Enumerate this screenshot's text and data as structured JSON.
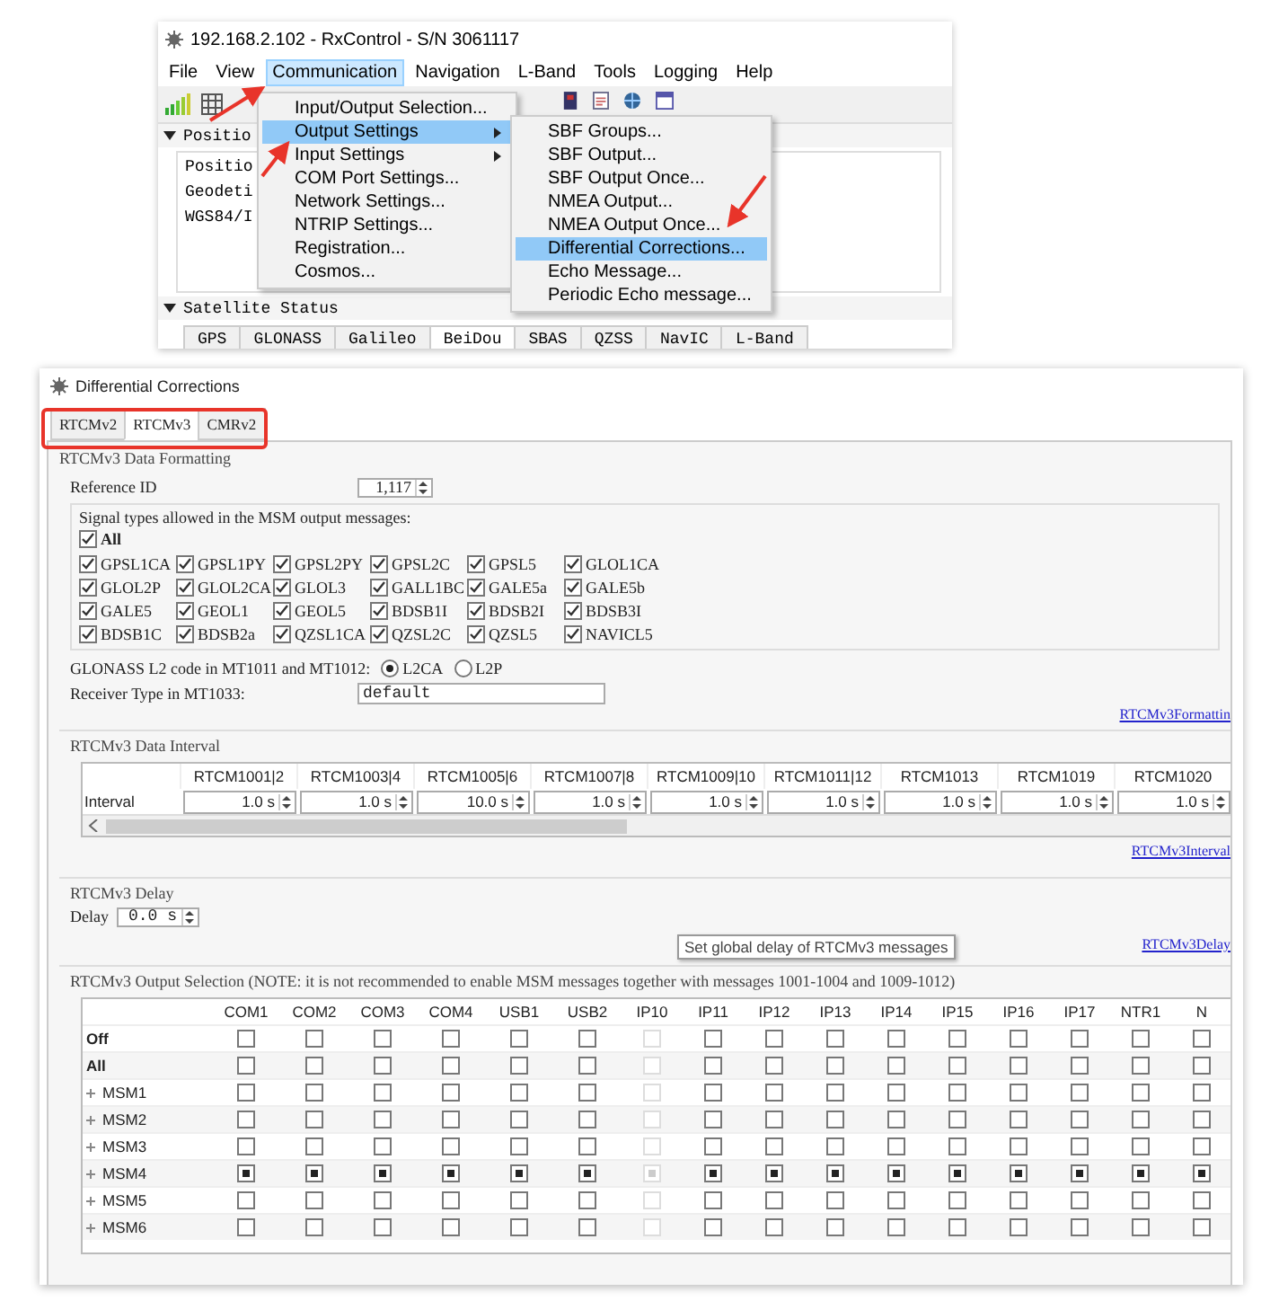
{
  "top_window": {
    "title": "192.168.2.102 - RxControl - S/N 3061117",
    "menu": [
      {
        "label": "File",
        "selected": false
      },
      {
        "label": "View",
        "selected": false
      },
      {
        "label": "Communication",
        "selected": true
      },
      {
        "label": "Navigation",
        "selected": false
      },
      {
        "label": "L-Band",
        "selected": false
      },
      {
        "label": "Tools",
        "selected": false
      },
      {
        "label": "Logging",
        "selected": false
      },
      {
        "label": "Help",
        "selected": false
      }
    ],
    "position_panel": {
      "header": "Positio",
      "tab": "Positio",
      "lines": [
        "Geodeti",
        "WGS84/I"
      ]
    },
    "satellite_panel": {
      "header": "Satellite Status",
      "tabs": [
        {
          "label": "GPS",
          "selected": false
        },
        {
          "label": "GLONASS",
          "selected": false
        },
        {
          "label": "Galileo",
          "selected": false
        },
        {
          "label": "BeiDou",
          "selected": true
        },
        {
          "label": "SBAS",
          "selected": false
        },
        {
          "label": "QZSS",
          "selected": false
        },
        {
          "label": "NavIC",
          "selected": false
        },
        {
          "label": "L-Band",
          "selected": false
        }
      ]
    },
    "dropdown": [
      {
        "label": "Input/Output Selection...",
        "submenu": false,
        "selected": false
      },
      {
        "label": "Output Settings",
        "submenu": true,
        "selected": true
      },
      {
        "label": "Input Settings",
        "submenu": true,
        "selected": false
      },
      {
        "label": "COM Port Settings...",
        "submenu": false,
        "selected": false
      },
      {
        "label": "Network Settings...",
        "submenu": false,
        "selected": false
      },
      {
        "label": "NTRIP Settings...",
        "submenu": false,
        "selected": false
      },
      {
        "label": "Registration...",
        "submenu": false,
        "selected": false
      },
      {
        "label": "Cosmos...",
        "submenu": false,
        "selected": false
      }
    ],
    "submenu": [
      {
        "label": "SBF Groups...",
        "selected": false
      },
      {
        "label": "SBF Output...",
        "selected": false
      },
      {
        "label": "SBF Output Once...",
        "selected": false
      },
      {
        "label": "NMEA Output...",
        "selected": false
      },
      {
        "label": "NMEA Output Once...",
        "selected": false
      },
      {
        "label": "Differential Corrections...",
        "selected": true
      },
      {
        "label": "Echo Message...",
        "selected": false
      },
      {
        "label": "Periodic Echo message...",
        "selected": false
      }
    ]
  },
  "dialog": {
    "title": "Differential Corrections",
    "tabs": [
      {
        "label": "RTCMv2",
        "selected": false
      },
      {
        "label": "RTCMv3",
        "selected": true
      },
      {
        "label": "CMRv2",
        "selected": false
      }
    ],
    "formatting": {
      "title": "RTCMv3 Data Formatting",
      "reference_id": {
        "label": "Reference ID",
        "value": "1,117"
      },
      "signals": {
        "title": "Signal types allowed in the MSM output messages:",
        "all": {
          "label": "All",
          "checked": true
        },
        "items": [
          {
            "label": "GPSL1CA",
            "checked": true
          },
          {
            "label": "GPSL1PY",
            "checked": true
          },
          {
            "label": "GPSL2PY",
            "checked": true
          },
          {
            "label": "GPSL2C",
            "checked": true
          },
          {
            "label": "GPSL5",
            "checked": true
          },
          {
            "label": "GLOL1CA",
            "checked": true
          },
          {
            "label": "GLOL2P",
            "checked": true
          },
          {
            "label": "GLOL2CA",
            "checked": true
          },
          {
            "label": "GLOL3",
            "checked": true
          },
          {
            "label": "GALL1BC",
            "checked": true
          },
          {
            "label": "GALE5a",
            "checked": true
          },
          {
            "label": "GALE5b",
            "checked": true
          },
          {
            "label": "GALE5",
            "checked": true
          },
          {
            "label": "GEOL1",
            "checked": true
          },
          {
            "label": "GEOL5",
            "checked": true
          },
          {
            "label": "BDSB1I",
            "checked": true
          },
          {
            "label": "BDSB2I",
            "checked": true
          },
          {
            "label": "BDSB3I",
            "checked": true
          },
          {
            "label": "BDSB1C",
            "checked": true
          },
          {
            "label": "BDSB2a",
            "checked": true
          },
          {
            "label": "QZSL1CA",
            "checked": true
          },
          {
            "label": "QZSL2C",
            "checked": true
          },
          {
            "label": "QZSL5",
            "checked": true
          },
          {
            "label": "NAVICL5",
            "checked": true
          }
        ]
      },
      "glonass": {
        "label": "GLONASS L2 code in MT1011 and MT1012:",
        "options": [
          {
            "label": "L2CA",
            "selected": true
          },
          {
            "label": "L2P",
            "selected": false
          }
        ]
      },
      "receiver_type": {
        "label": "Receiver Type in MT1033:",
        "value": "default"
      },
      "link": "RTCMv3Formattin"
    },
    "interval": {
      "title": "RTCMv3 Data Interval",
      "columns": [
        "RTCM1001|2",
        "RTCM1003|4",
        "RTCM1005|6",
        "RTCM1007|8",
        "RTCM1009|10",
        "RTCM1011|12",
        "RTCM1013",
        "RTCM1019",
        "RTCM1020"
      ],
      "row_label": "Interval",
      "values": [
        "1.0 s",
        "1.0 s",
        "10.0 s",
        "1.0 s",
        "1.0 s",
        "1.0 s",
        "1.0 s",
        "1.0 s",
        "1.0 s"
      ],
      "link": "RTCMv3Interval"
    },
    "delay": {
      "title": "RTCMv3 Delay",
      "label": "Delay",
      "value": "0.0 s",
      "tooltip": "Set global delay of RTCMv3 messages",
      "link": "RTCMv3Delay"
    },
    "output": {
      "title": "RTCMv3 Output Selection (NOTE: it is not recommended to enable MSM messages together with messages 1001-1004 and 1009-1012)",
      "columns": [
        {
          "label": "COM1",
          "disabled": false
        },
        {
          "label": "COM2",
          "disabled": false
        },
        {
          "label": "COM3",
          "disabled": false
        },
        {
          "label": "COM4",
          "disabled": false
        },
        {
          "label": "USB1",
          "disabled": false
        },
        {
          "label": "USB2",
          "disabled": false
        },
        {
          "label": "IP10",
          "disabled": true
        },
        {
          "label": "IP11",
          "disabled": false
        },
        {
          "label": "IP12",
          "disabled": false
        },
        {
          "label": "IP13",
          "disabled": false
        },
        {
          "label": "IP14",
          "disabled": false
        },
        {
          "label": "IP15",
          "disabled": false
        },
        {
          "label": "IP16",
          "disabled": false
        },
        {
          "label": "IP17",
          "disabled": false
        },
        {
          "label": "NTR1",
          "disabled": false
        },
        {
          "label": "N",
          "disabled": false
        }
      ],
      "rows": [
        {
          "label": "Off",
          "kind": "option",
          "checked": [
            false,
            false,
            false,
            false,
            false,
            false,
            false,
            false,
            false,
            false,
            false,
            false,
            false,
            false,
            false,
            false
          ]
        },
        {
          "label": "All",
          "kind": "option",
          "checked": [
            false,
            false,
            false,
            false,
            false,
            false,
            false,
            false,
            false,
            false,
            false,
            false,
            false,
            false,
            false,
            false
          ]
        },
        {
          "label": "MSM1",
          "kind": "group",
          "checked": [
            false,
            false,
            false,
            false,
            false,
            false,
            false,
            false,
            false,
            false,
            false,
            false,
            false,
            false,
            false,
            false
          ]
        },
        {
          "label": "MSM2",
          "kind": "group",
          "checked": [
            false,
            false,
            false,
            false,
            false,
            false,
            false,
            false,
            false,
            false,
            false,
            false,
            false,
            false,
            false,
            false
          ]
        },
        {
          "label": "MSM3",
          "kind": "group",
          "checked": [
            false,
            false,
            false,
            false,
            false,
            false,
            false,
            false,
            false,
            false,
            false,
            false,
            false,
            false,
            false,
            false
          ]
        },
        {
          "label": "MSM4",
          "kind": "group",
          "checked": [
            true,
            true,
            true,
            true,
            true,
            true,
            true,
            true,
            true,
            true,
            true,
            true,
            true,
            true,
            true,
            true
          ]
        },
        {
          "label": "MSM5",
          "kind": "group",
          "checked": [
            false,
            false,
            false,
            false,
            false,
            false,
            false,
            false,
            false,
            false,
            false,
            false,
            false,
            false,
            false,
            false
          ]
        },
        {
          "label": "MSM6",
          "kind": "group",
          "checked": [
            false,
            false,
            false,
            false,
            false,
            false,
            false,
            false,
            false,
            false,
            false,
            false,
            false,
            false,
            false,
            false
          ]
        }
      ]
    }
  }
}
